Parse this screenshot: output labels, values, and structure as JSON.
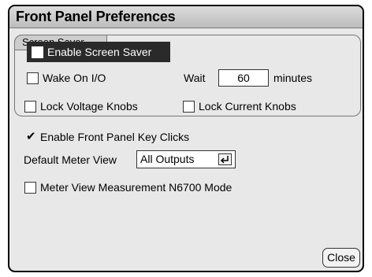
{
  "dialog": {
    "title": "Front Panel Preferences"
  },
  "screen_saver": {
    "group_label": "Screen Saver",
    "enable": {
      "label": "Enable Screen Saver",
      "checked": false
    },
    "wake_on_io": {
      "label": "Wake On I/O",
      "checked": false
    },
    "wait_label": "Wait",
    "wait_value": "60",
    "wait_unit": "minutes"
  },
  "locks": {
    "voltage": {
      "label": "Lock Voltage Knobs",
      "checked": false
    },
    "current": {
      "label": "Lock Current Knobs",
      "checked": false
    }
  },
  "key_clicks": {
    "label": "Enable Front Panel Key Clicks",
    "checked": true,
    "check_glyph": "✔"
  },
  "meter_view": {
    "label": "Default Meter View",
    "selected": "All Outputs",
    "enter_icon": "enter-icon"
  },
  "n6700_mode": {
    "label": "Meter View Measurement N6700 Mode",
    "checked": false
  },
  "buttons": {
    "close": "Close"
  }
}
